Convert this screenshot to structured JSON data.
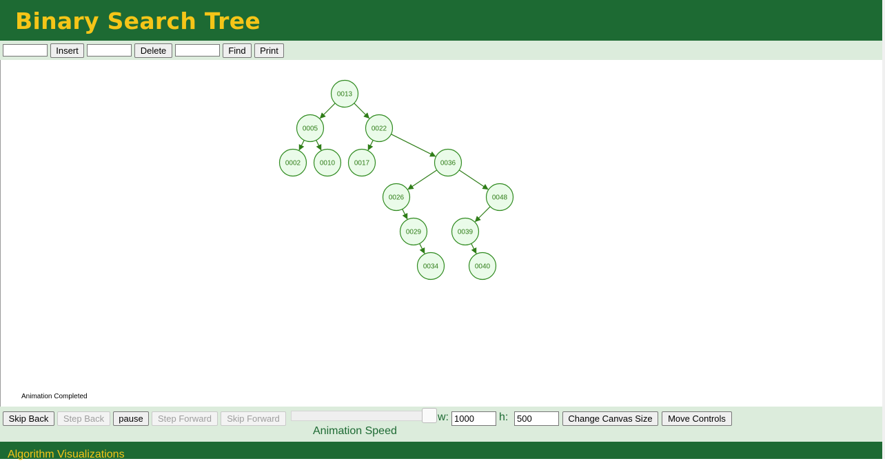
{
  "header": {
    "title": "Binary Search Tree"
  },
  "toolbar": {
    "insert_value": "",
    "insert_label": "Insert",
    "delete_value": "",
    "delete_label": "Delete",
    "find_value": "",
    "find_label": "Find",
    "print_label": "Print"
  },
  "tree": {
    "nodes": [
      {
        "id": "n13",
        "label": "0013"
      },
      {
        "id": "n5",
        "label": "0005"
      },
      {
        "id": "n22",
        "label": "0022"
      },
      {
        "id": "n2",
        "label": "0002"
      },
      {
        "id": "n10",
        "label": "0010"
      },
      {
        "id": "n17",
        "label": "0017"
      },
      {
        "id": "n36",
        "label": "0036"
      },
      {
        "id": "n26",
        "label": "0026"
      },
      {
        "id": "n48",
        "label": "0048"
      },
      {
        "id": "n29",
        "label": "0029"
      },
      {
        "id": "n39",
        "label": "0039"
      },
      {
        "id": "n34",
        "label": "0034"
      },
      {
        "id": "n40",
        "label": "0040"
      }
    ],
    "edges": [
      [
        "n13",
        "n5"
      ],
      [
        "n13",
        "n22"
      ],
      [
        "n5",
        "n2"
      ],
      [
        "n5",
        "n10"
      ],
      [
        "n22",
        "n17"
      ],
      [
        "n22",
        "n36"
      ],
      [
        "n36",
        "n26"
      ],
      [
        "n36",
        "n48"
      ],
      [
        "n26",
        "n29"
      ],
      [
        "n48",
        "n39"
      ],
      [
        "n29",
        "n34"
      ],
      [
        "n39",
        "n40"
      ]
    ],
    "colors": {
      "node_fill": "#eafbe9",
      "node_stroke": "#2f8a1f",
      "edge": "#2f7d18"
    }
  },
  "status": {
    "text": "Animation Completed"
  },
  "controls": {
    "skip_back": "Skip Back",
    "step_back": "Step Back",
    "pause": "pause",
    "step_forward": "Step Forward",
    "skip_forward": "Skip Forward",
    "speed_label": "Animation Speed",
    "w_label": "w:",
    "w_value": "1000",
    "h_label": "h:",
    "h_value": "500",
    "change_canvas": "Change Canvas Size",
    "move_controls": "Move Controls"
  },
  "footer": {
    "text": "Algorithm Visualizations"
  },
  "theme": {
    "primary": "#1d6a33",
    "accent": "#f5c518",
    "panel": "#dcecdc"
  }
}
